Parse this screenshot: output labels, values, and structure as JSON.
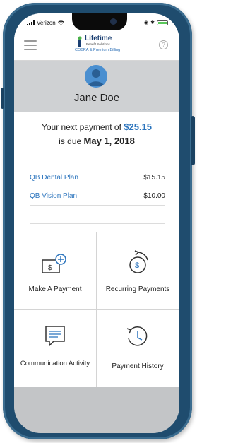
{
  "status_bar": {
    "carrier": "Verizon"
  },
  "app": {
    "logo_title": "Lifetime",
    "logo_subtitle": "Benefit Solutions",
    "logo_tagline": "COBRA & Premium Billing",
    "help_glyph": "?"
  },
  "profile": {
    "name": "Jane Doe"
  },
  "payment": {
    "prefix": "Your next payment of ",
    "amount": "$25.15",
    "due_prefix": "is due ",
    "due_date": "May 1, 2018"
  },
  "plans": [
    {
      "name": "QB Dental Plan",
      "amount": "$15.15"
    },
    {
      "name": "QB Vision Plan",
      "amount": "$10.00"
    }
  ],
  "actions": {
    "make_payment": "Make A Payment",
    "recurring": "Recurring Payments",
    "communication": "Communication Activity",
    "history": "Payment History"
  },
  "colors": {
    "accent": "#2b74bd",
    "frame": "#1f4c6e",
    "avatar": "#4a8fd0"
  },
  "icons": {
    "menu": "hamburger-menu-icon",
    "help": "help-icon",
    "make_payment": "add-payment-icon",
    "recurring": "recurring-payment-icon",
    "communication": "message-icon",
    "history": "history-clock-icon"
  }
}
